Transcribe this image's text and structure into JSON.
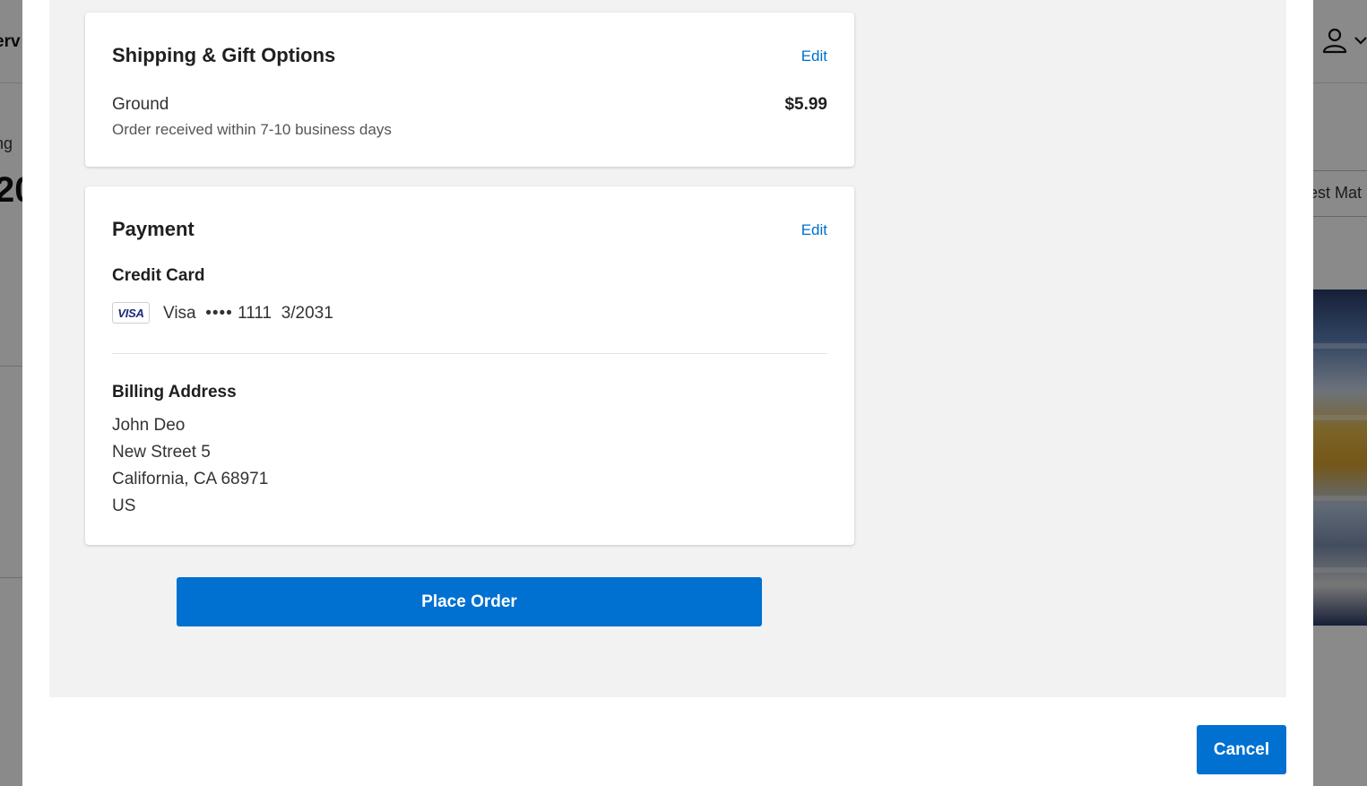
{
  "background": {
    "nav_fragment": "erv",
    "left_small_fragment": "ng",
    "left_big_fragment": "20",
    "sort_fragment": "est Mat"
  },
  "shipping": {
    "title": "Shipping & Gift Options",
    "edit_label": "Edit",
    "method": "Ground",
    "description": "Order received within 7-10 business days",
    "price": "$5.99"
  },
  "payment": {
    "title": "Payment",
    "edit_label": "Edit",
    "method_label": "Credit Card",
    "card_brand_logo": "VISA",
    "card_brand": "Visa",
    "card_mask": "••••",
    "card_last4": "1111",
    "card_expiry": "3/2031",
    "billing_label": "Billing Address",
    "billing_address": {
      "name": "John Deo",
      "street": "New Street 5",
      "city_state_zip": "California, CA 68971",
      "country": "US"
    }
  },
  "actions": {
    "place_order_label": "Place Order",
    "cancel_label": "Cancel"
  },
  "colors": {
    "accent": "#0070d1",
    "link": "#0070cc",
    "modal_body_bg": "#f2f2f2"
  },
  "icons": {
    "user": "user-icon",
    "chevron": "chevron-down-icon",
    "card_brand": "visa-logo"
  }
}
